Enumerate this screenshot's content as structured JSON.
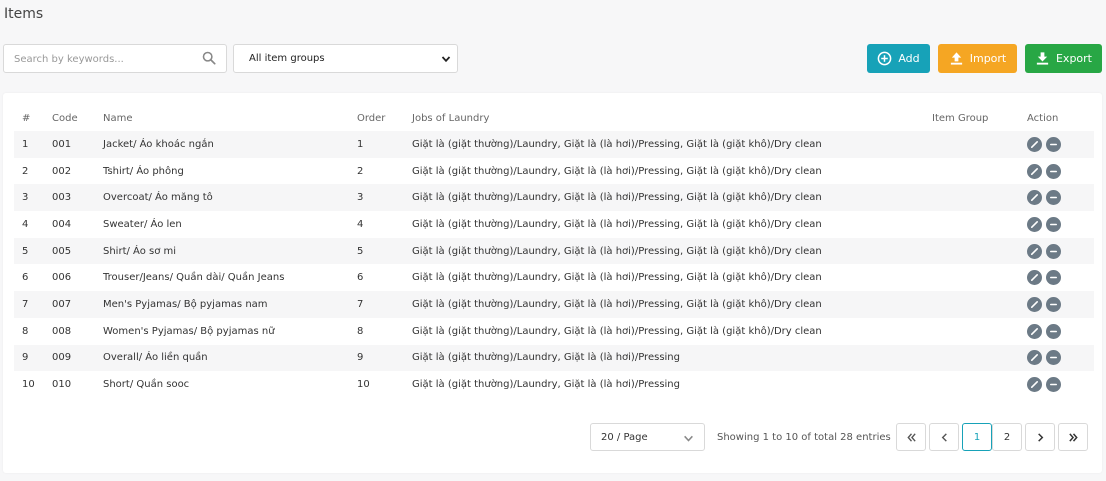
{
  "page": {
    "title": "Items"
  },
  "search": {
    "placeholder": "Search by keywords..."
  },
  "filter": {
    "selected": "All item groups"
  },
  "buttons": {
    "add": "Add",
    "import": "Import",
    "export": "Export"
  },
  "table": {
    "headers": {
      "num": "#",
      "code": "Code",
      "name": "Name",
      "order": "Order",
      "jobs": "Jobs of Laundry",
      "group": "Item Group",
      "action": "Action"
    },
    "rows": [
      {
        "num": "1",
        "code": "001",
        "name": "Jacket/ Áo khoác ngắn",
        "order": "1",
        "jobs": "Giặt là (giặt thường)/Laundry, Giặt là (là hơi)/Pressing, Giặt là (giặt khô)/Dry clean",
        "group": ""
      },
      {
        "num": "2",
        "code": "002",
        "name": "Tshirt/ Áo phông",
        "order": "2",
        "jobs": "Giặt là (giặt thường)/Laundry, Giặt là (là hơi)/Pressing, Giặt là (giặt khô)/Dry clean",
        "group": ""
      },
      {
        "num": "3",
        "code": "003",
        "name": "Overcoat/ Áo măng tô",
        "order": "3",
        "jobs": "Giặt là (giặt thường)/Laundry, Giặt là (là hơi)/Pressing, Giặt là (giặt khô)/Dry clean",
        "group": ""
      },
      {
        "num": "4",
        "code": "004",
        "name": "Sweater/ Áo len",
        "order": "4",
        "jobs": "Giặt là (giặt thường)/Laundry, Giặt là (là hơi)/Pressing, Giặt là (giặt khô)/Dry clean",
        "group": ""
      },
      {
        "num": "5",
        "code": "005",
        "name": "Shirt/ Áo sơ mi",
        "order": "5",
        "jobs": "Giặt là (giặt thường)/Laundry, Giặt là (là hơi)/Pressing, Giặt là (giặt khô)/Dry clean",
        "group": ""
      },
      {
        "num": "6",
        "code": "006",
        "name": "Trouser/Jeans/ Quần dài/ Quần Jeans",
        "order": "6",
        "jobs": "Giặt là (giặt thường)/Laundry, Giặt là (là hơi)/Pressing, Giặt là (giặt khô)/Dry clean",
        "group": ""
      },
      {
        "num": "7",
        "code": "007",
        "name": "Men's Pyjamas/ Bộ pyjamas nam",
        "order": "7",
        "jobs": "Giặt là (giặt thường)/Laundry, Giặt là (là hơi)/Pressing, Giặt là (giặt khô)/Dry clean",
        "group": ""
      },
      {
        "num": "8",
        "code": "008",
        "name": "Women's Pyjamas/ Bộ pyjamas nữ",
        "order": "8",
        "jobs": "Giặt là (giặt thường)/Laundry, Giặt là (là hơi)/Pressing, Giặt là (giặt khô)/Dry clean",
        "group": ""
      },
      {
        "num": "9",
        "code": "009",
        "name": "Overall/ Áo liền quần",
        "order": "9",
        "jobs": "Giặt là (giặt thường)/Laundry, Giặt là (là hơi)/Pressing",
        "group": ""
      },
      {
        "num": "10",
        "code": "010",
        "name": "Short/ Quần sooc",
        "order": "10",
        "jobs": "Giặt là (giặt thường)/Laundry, Giặt là (là hơi)/Pressing",
        "group": ""
      }
    ]
  },
  "pagination": {
    "page_size": "20 / Page",
    "info": "Showing 1 to 10 of total 28 entries",
    "pages": [
      "1",
      "2"
    ],
    "current": "1"
  },
  "icons": {
    "search": "search-icon",
    "add": "plus-circle-icon",
    "import": "upload-icon",
    "export": "download-icon",
    "edit": "pencil-icon",
    "delete": "minus-circle-icon",
    "first": "double-chevron-left-icon",
    "prev": "chevron-left-icon",
    "next": "chevron-right-icon",
    "last": "double-chevron-right-icon"
  },
  "colors": {
    "add": "#17a2b8",
    "import": "#f5a623",
    "export": "#28a745",
    "action_icon": "#6c7a86",
    "active_page": "#17a2b8"
  }
}
